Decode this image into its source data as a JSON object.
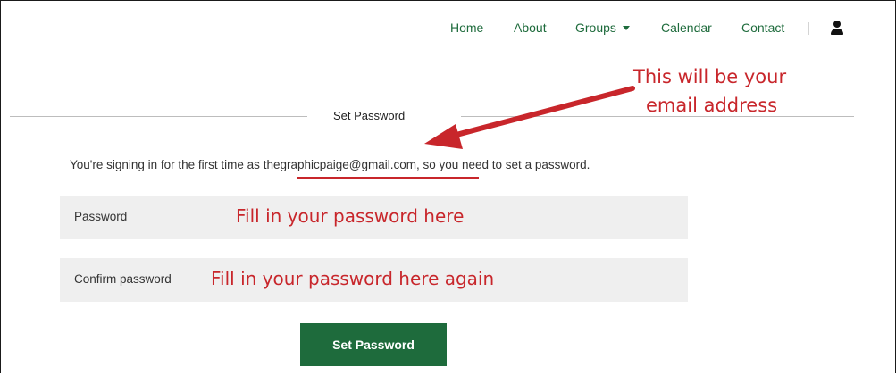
{
  "nav": {
    "items": [
      {
        "label": "Home"
      },
      {
        "label": "About"
      },
      {
        "label": "Groups"
      },
      {
        "label": "Calendar"
      },
      {
        "label": "Contact"
      }
    ],
    "user_icon": "user-icon"
  },
  "form": {
    "section_title": "Set Password",
    "intro_prefix": "You're signing in for the first time as ",
    "email": "thegraphicpaige@gmail.com",
    "intro_suffix": ", so you need to set a password.",
    "password_label": "Password",
    "confirm_label": "Confirm password",
    "submit_label": "Set Password"
  },
  "annotations": {
    "email_note_line1": "This will be your",
    "email_note_line2": "email address",
    "password_note": "Fill in your password here",
    "confirm_note": "Fill in your password here again"
  },
  "colors": {
    "brand_green": "#1e6b3c",
    "annotation_red": "#c8262b",
    "field_bg": "#efefef"
  }
}
